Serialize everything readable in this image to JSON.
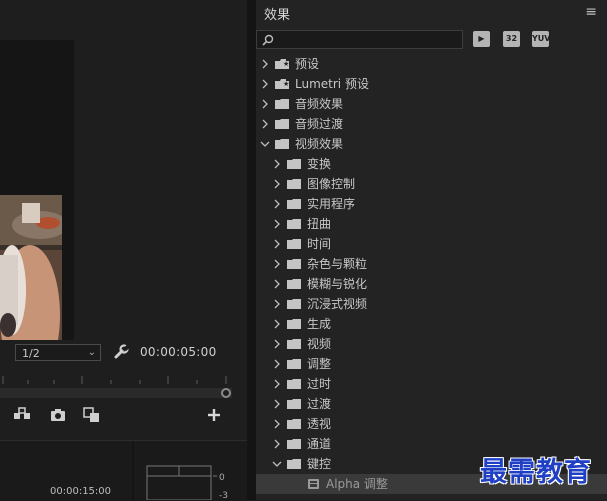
{
  "program_monitor": {
    "scale": "1/2",
    "timecode": "00:00:05:00",
    "bottom_timecode": "00:00:15:00",
    "meter_labels": [
      "0",
      "-3"
    ]
  },
  "effects_panel": {
    "title": "效果",
    "menu": "≡",
    "search": {
      "value": "",
      "placeholder": ""
    },
    "filter_badges": [
      "32",
      "YUV"
    ],
    "tree": [
      {
        "label": "预设",
        "level": 0,
        "expanded": false,
        "icon": "preset-folder-icon"
      },
      {
        "label": "Lumetri 预设",
        "level": 0,
        "expanded": false,
        "icon": "preset-folder-icon"
      },
      {
        "label": "音频效果",
        "level": 0,
        "expanded": false,
        "icon": "folder-icon"
      },
      {
        "label": "音频过渡",
        "level": 0,
        "expanded": false,
        "icon": "folder-icon"
      },
      {
        "label": "视频效果",
        "level": 0,
        "expanded": true,
        "icon": "folder-icon"
      },
      {
        "label": "变换",
        "level": 1,
        "expanded": false,
        "icon": "folder-icon"
      },
      {
        "label": "图像控制",
        "level": 1,
        "expanded": false,
        "icon": "folder-icon"
      },
      {
        "label": "实用程序",
        "level": 1,
        "expanded": false,
        "icon": "folder-icon"
      },
      {
        "label": "扭曲",
        "level": 1,
        "expanded": false,
        "icon": "folder-icon"
      },
      {
        "label": "时间",
        "level": 1,
        "expanded": false,
        "icon": "folder-icon"
      },
      {
        "label": "杂色与颗粒",
        "level": 1,
        "expanded": false,
        "icon": "folder-icon"
      },
      {
        "label": "模糊与锐化",
        "level": 1,
        "expanded": false,
        "icon": "folder-icon"
      },
      {
        "label": "沉浸式视频",
        "level": 1,
        "expanded": false,
        "icon": "folder-icon"
      },
      {
        "label": "生成",
        "level": 1,
        "expanded": false,
        "icon": "folder-icon"
      },
      {
        "label": "视频",
        "level": 1,
        "expanded": false,
        "icon": "folder-icon"
      },
      {
        "label": "调整",
        "level": 1,
        "expanded": false,
        "icon": "folder-icon"
      },
      {
        "label": "过时",
        "level": 1,
        "expanded": false,
        "icon": "folder-icon"
      },
      {
        "label": "过渡",
        "level": 1,
        "expanded": false,
        "icon": "folder-icon"
      },
      {
        "label": "透视",
        "level": 1,
        "expanded": false,
        "icon": "folder-icon"
      },
      {
        "label": "通道",
        "level": 1,
        "expanded": false,
        "icon": "folder-icon"
      },
      {
        "label": "键控",
        "level": 1,
        "expanded": true,
        "icon": "folder-icon"
      },
      {
        "label": "Alpha 调整",
        "level": 2,
        "expanded": null,
        "icon": "effect-icon",
        "selected": true
      }
    ]
  },
  "watermark": "最需教育"
}
